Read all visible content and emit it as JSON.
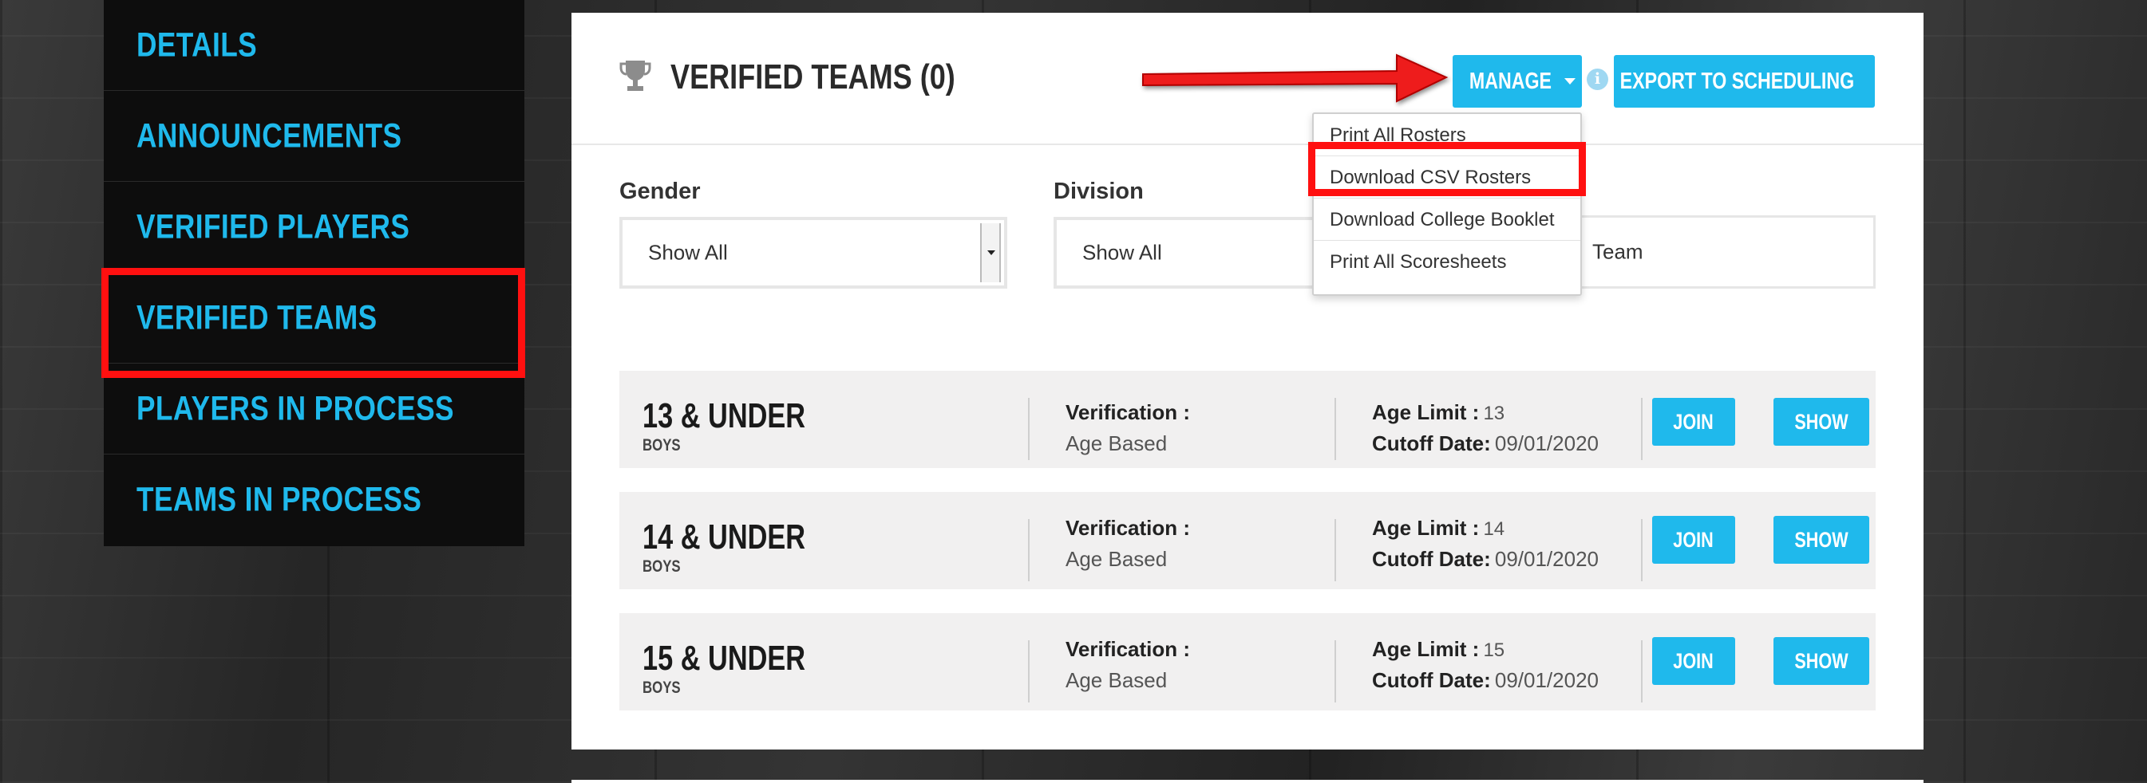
{
  "sidebar": {
    "items": [
      {
        "label": "DETAILS"
      },
      {
        "label": "ANNOUNCEMENTS"
      },
      {
        "label": "VERIFIED PLAYERS"
      },
      {
        "label": "VERIFIED TEAMS"
      },
      {
        "label": "PLAYERS IN PROCESS"
      },
      {
        "label": "TEAMS IN PROCESS"
      }
    ]
  },
  "header": {
    "title": "VERIFIED TEAMS (0)",
    "manage_label": "MANAGE",
    "export_label": "EXPORT TO SCHEDULING",
    "info_glyph": "i"
  },
  "manage_menu": {
    "items": [
      {
        "label": "Print All Rosters"
      },
      {
        "label": "Download CSV Rosters"
      },
      {
        "label": "Download College Booklet"
      },
      {
        "label": "Print All Scoresheets"
      }
    ]
  },
  "filters": {
    "gender_label": "Gender",
    "gender_value": "Show All",
    "division_label": "Division",
    "division_value": "Show All",
    "team_value": "Team"
  },
  "divisions": [
    {
      "name": "13 & UNDER",
      "gender": "BOYS",
      "verification_label": "Verification :",
      "verification": "Age Based",
      "age_limit_label": "Age Limit :",
      "age_limit": "13",
      "cutoff_label": "Cutoff Date:",
      "cutoff": "09/01/2020",
      "join_label": "JOIN",
      "show_label": "SHOW"
    },
    {
      "name": "14 & UNDER",
      "gender": "BOYS",
      "verification_label": "Verification :",
      "verification": "Age Based",
      "age_limit_label": "Age Limit :",
      "age_limit": "14",
      "cutoff_label": "Cutoff Date:",
      "cutoff": "09/01/2020",
      "join_label": "JOIN",
      "show_label": "SHOW"
    },
    {
      "name": "15 & UNDER",
      "gender": "BOYS",
      "verification_label": "Verification :",
      "verification": "Age Based",
      "age_limit_label": "Age Limit :",
      "age_limit": "15",
      "cutoff_label": "Cutoff Date:",
      "cutoff": "09/01/2020",
      "join_label": "JOIN",
      "show_label": "SHOW"
    }
  ],
  "colors": {
    "accent": "#1fb9ec",
    "highlight": "#ff1010",
    "sidebar_bg": "#0d0d0d",
    "row_bg": "#f1f0f0"
  },
  "icons": {
    "trophy": "trophy-icon",
    "info": "info-icon",
    "caret": "caret-down-icon",
    "annotation_arrow": "arrow-pointer-icon"
  }
}
